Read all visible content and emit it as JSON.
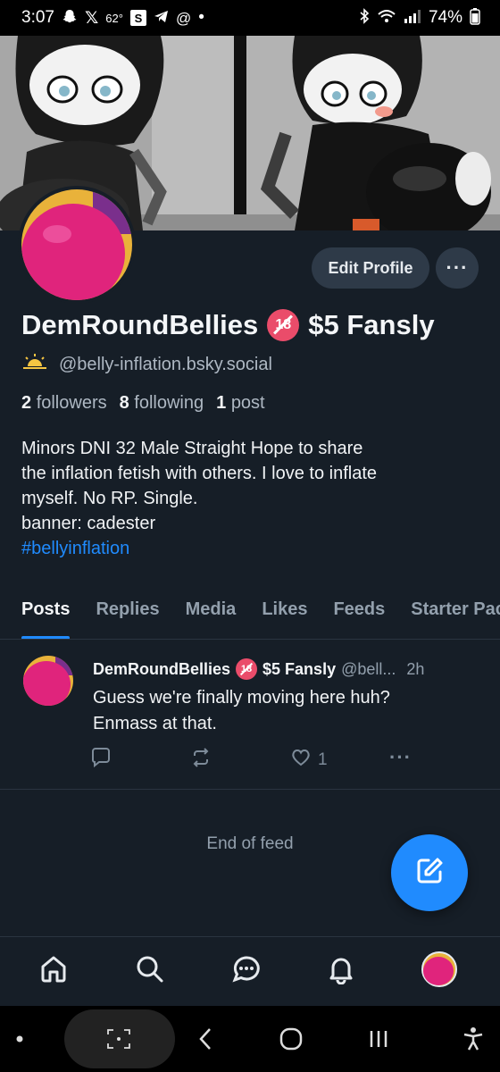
{
  "status_bar": {
    "time": "3:07",
    "temperature": "62°",
    "s_badge": "S",
    "battery": "74%",
    "dot": "•"
  },
  "profile": {
    "display_name": "DemRoundBellies",
    "badge_text": "18",
    "name_suffix": "$5 Fansly",
    "handle": "@belly-inflation.bsky.social",
    "followers_count": "2",
    "followers_label": "followers",
    "following_count": "8",
    "following_label": "following",
    "posts_count": "1",
    "posts_label": "post",
    "bio_lines": [
      "Minors DNI 32 Male Straight Hope to share",
      "the inflation fetish with others. I love to inflate",
      "myself. No RP. Single.",
      "banner: cadester"
    ],
    "bio_hashtag": "#bellyinflation"
  },
  "buttons": {
    "edit_profile": "Edit Profile",
    "more": "···"
  },
  "tabs": [
    {
      "label": "Posts",
      "active": true
    },
    {
      "label": "Replies",
      "active": false
    },
    {
      "label": "Media",
      "active": false
    },
    {
      "label": "Likes",
      "active": false
    },
    {
      "label": "Feeds",
      "active": false
    },
    {
      "label": "Starter Packs",
      "active": false
    }
  ],
  "post": {
    "author": "DemRoundBellies",
    "badge_text": "18",
    "author_suffix": "$5 Fansly",
    "handle": "@bell...",
    "time": "2h",
    "text_lines": [
      "Guess we're finally moving here huh?",
      "Enmass at that."
    ],
    "reply_count": "",
    "repost_count": "",
    "like_count": "1",
    "more": "···"
  },
  "feed": {
    "end_text": "End of feed"
  },
  "colors": {
    "background": "#161e27",
    "accent": "#208bfe",
    "muted_text": "#93a0ad",
    "avatar_pink": "#e0247c",
    "button_bg": "#2e3a48"
  },
  "icons": {
    "nav": [
      "home-icon",
      "search-icon",
      "chat-icon",
      "bell-icon",
      "profile-avatar"
    ],
    "fab": "compose-icon"
  }
}
